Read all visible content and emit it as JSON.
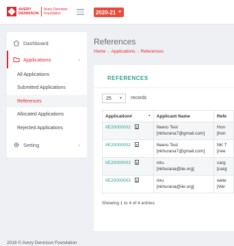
{
  "header": {
    "logo_line1": "AVERY",
    "logo_line2": "DENNISON",
    "logo_sub1": "Avery Dennison",
    "logo_sub2": "Foundation",
    "year": "2020-21"
  },
  "sidebar": {
    "items": [
      {
        "label": "Dashboard",
        "icon": "home-icon"
      },
      {
        "label": "Applications",
        "icon": "folder-icon"
      },
      {
        "label": "Setting",
        "icon": "gear-icon"
      }
    ],
    "sub_items": [
      {
        "label": "All Applications"
      },
      {
        "label": "Submitted Applications"
      },
      {
        "label": "References"
      },
      {
        "label": "Allocated Applications"
      },
      {
        "label": "Rejected Applications"
      }
    ]
  },
  "page": {
    "title": "References",
    "breadcrumb": [
      "Home",
      "Applications",
      "References"
    ]
  },
  "card": {
    "title": "REFERENCES",
    "page_length": "25",
    "records_label": "records",
    "columns": [
      "Application#",
      "Applicant Name",
      "Refe"
    ],
    "rows": [
      {
        "app": "IIE20000002",
        "name": "Neeru Test",
        "email": "[nkhurana7@gmail.com]",
        "ref1": "Hon",
        "ref2": "[hon"
      },
      {
        "app": "IIE20000002",
        "name": "Neeru Test",
        "email": "[nkhurana7@gmail.com]",
        "ref1": "NK T",
        "ref2": "[nee"
      },
      {
        "app": "IIE20000003",
        "name": "niru",
        "email": "[nkhurana@iie.org]",
        "ref1": "carg",
        "ref2": "[carg"
      },
      {
        "app": "IIE20000003",
        "name": "niru",
        "email": "[nkhurana@iie.org]",
        "ref1": "wete",
        "ref2": "[We'"
      }
    ],
    "info": "Showing 1 to 4 of 4 entries"
  },
  "footer": "2018 © Avery Dennison Foundation"
}
